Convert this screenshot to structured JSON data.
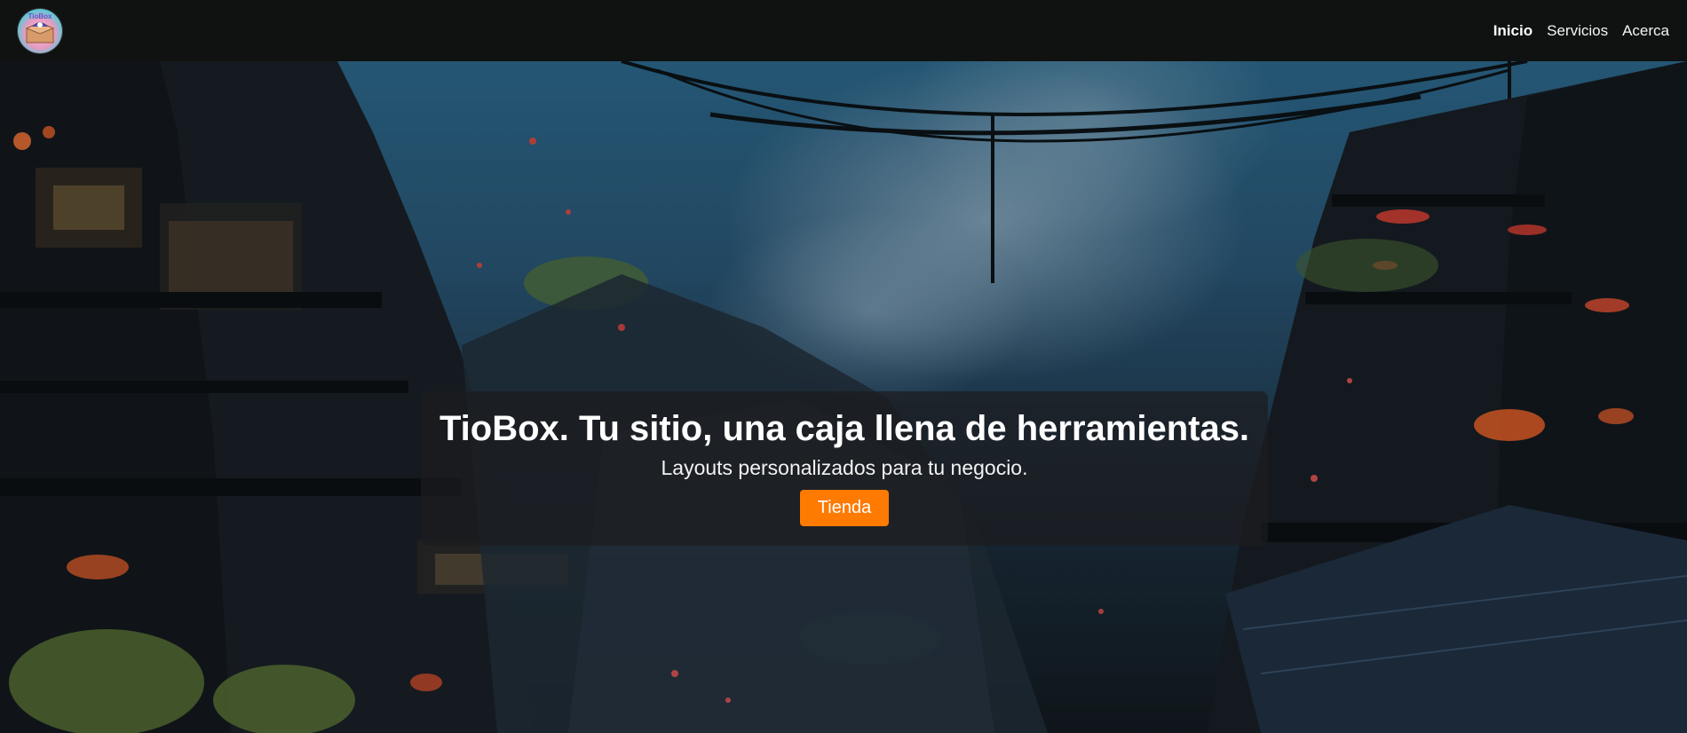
{
  "header": {
    "logo_text": "TioBox",
    "nav": [
      {
        "label": "Inicio",
        "active": true
      },
      {
        "label": "Servicios",
        "active": false
      },
      {
        "label": "Acerca",
        "active": false
      }
    ]
  },
  "hero": {
    "title": "TioBox. Tu sitio, una caja llena de herramientas.",
    "subtitle": "Layouts personalizados para tu negocio.",
    "button_label": "Tienda"
  },
  "colors": {
    "navbar_bg": "#101211",
    "accent": "#ff7a00",
    "card_bg": "rgba(28,28,30,0.72)"
  }
}
